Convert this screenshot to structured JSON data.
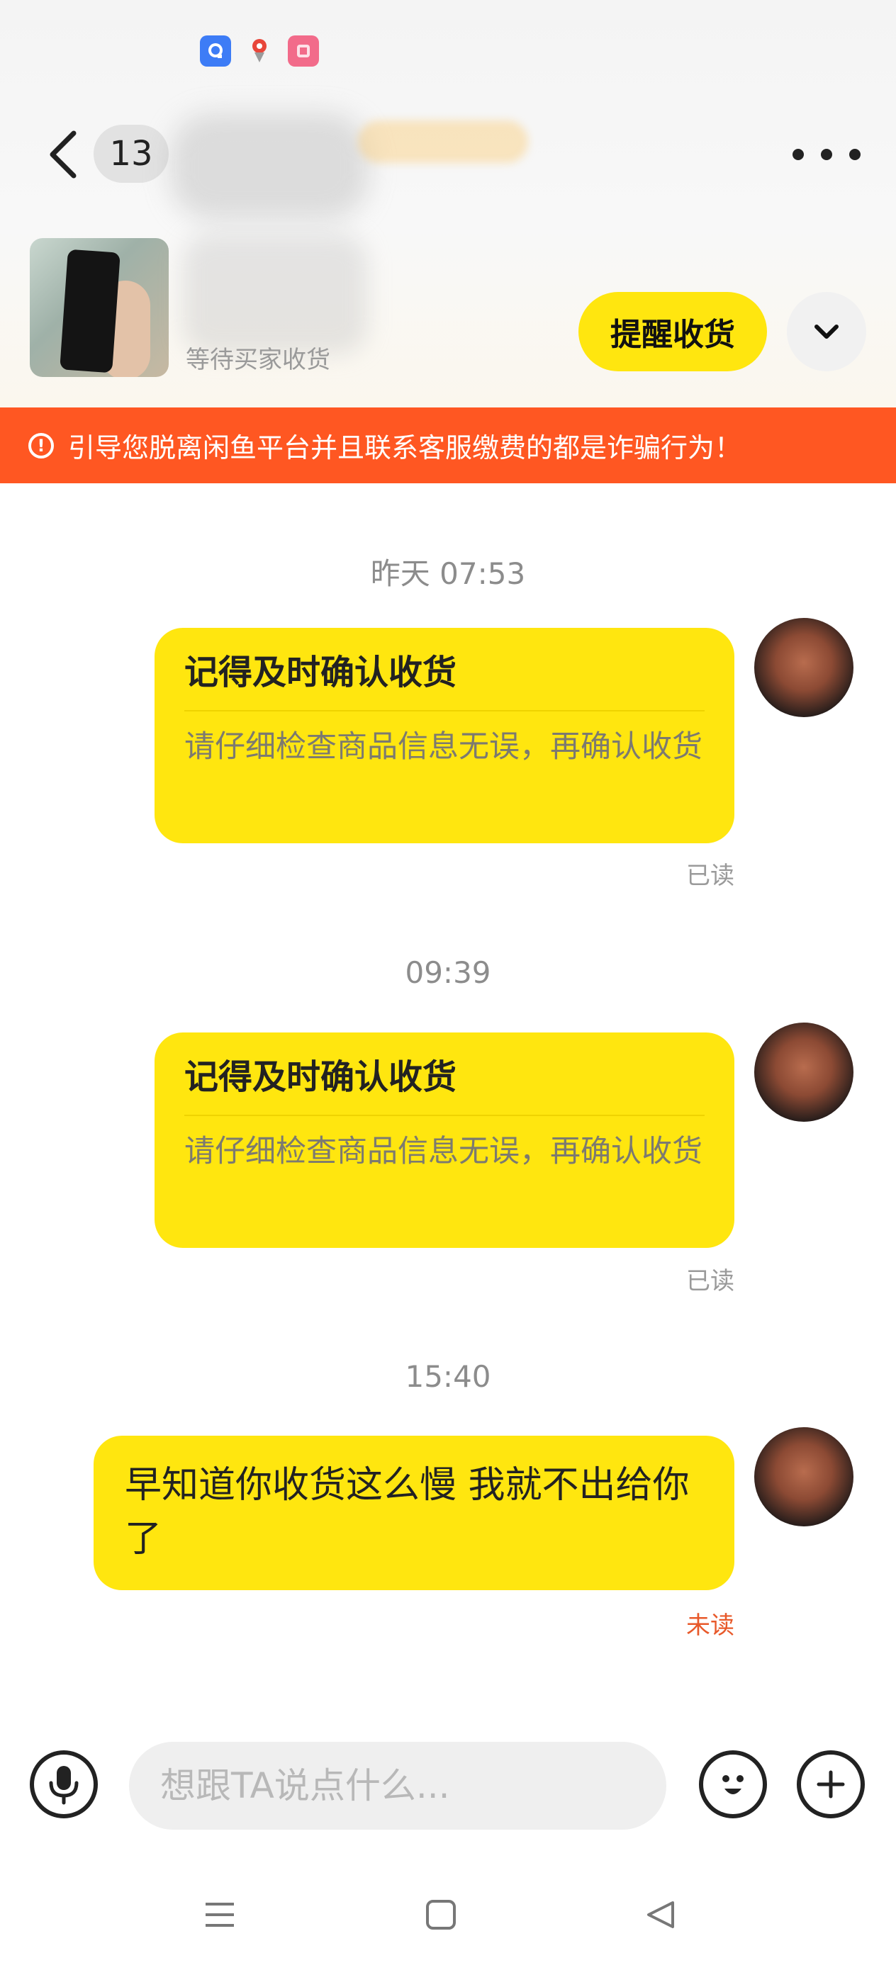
{
  "header": {
    "unread_count": "13"
  },
  "product": {
    "status": "等待买家收货",
    "remind_button": "提醒收货"
  },
  "warning": {
    "text": "引导您脱离闲鱼平台并且联系客服缴费的都是诈骗行为！",
    "icon_glyph": "!"
  },
  "messages": [
    {
      "timestamp": "昨天 07:53",
      "title": "记得及时确认收货",
      "body": "请仔细检查商品信息无误，再确认收货",
      "read_status": "已读"
    },
    {
      "timestamp": "09:39",
      "title": "记得及时确认收货",
      "body": "请仔细检查商品信息无误，再确认收货",
      "read_status": "已读"
    },
    {
      "timestamp": "15:40",
      "text": "早知道你收货这么慢  我就不出给你了",
      "read_status": "未读"
    }
  ],
  "input": {
    "placeholder": "想跟TA说点什么..."
  },
  "icons": {
    "status_bar": [
      "qq-icon",
      "map-pin-icon",
      "app-icon"
    ],
    "back": "chevron-left-icon",
    "more": "more-dots-icon",
    "expand": "chevron-down-icon",
    "mic": "microphone-icon",
    "emoji": "emoji-icon",
    "plus": "plus-icon",
    "nav": [
      "menu-icon",
      "home-icon",
      "back-triangle-icon"
    ]
  },
  "colors": {
    "accent_yellow": "#ffe60f",
    "warning_orange": "#ff5722",
    "unread_red": "#e8592a"
  }
}
